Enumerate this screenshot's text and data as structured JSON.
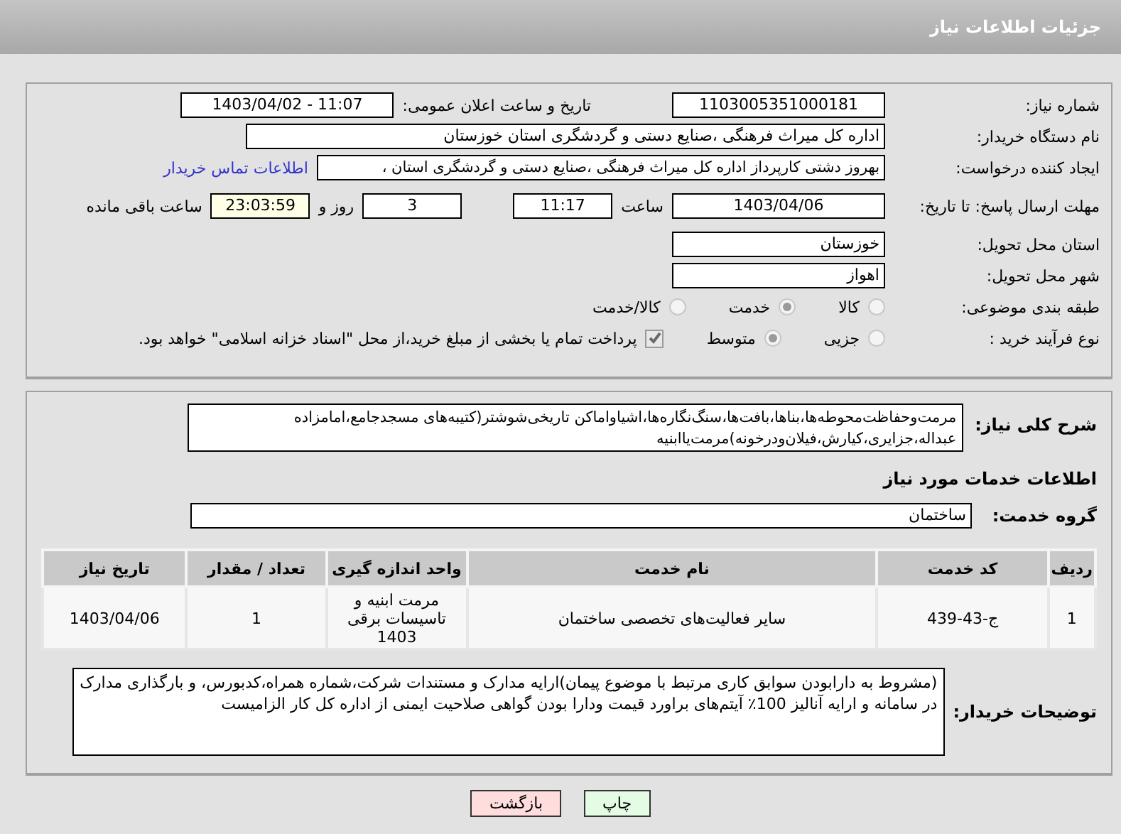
{
  "header": {
    "title": "جزئیات اطلاعات نیاز"
  },
  "need_number": {
    "label": "شماره نیاز:",
    "value": "1103005351000181"
  },
  "announce": {
    "label": "تاریخ و ساعت اعلان عمومی:",
    "value": "1403/04/02 - 11:07"
  },
  "buyer_org": {
    "label": "نام دستگاه خریدار:",
    "value": "اداره کل میراث فرهنگی ،صنایع دستی و گردشگری استان خوزستان"
  },
  "requester": {
    "label": "ایجاد کننده درخواست:",
    "value": "بهروز دشتی کارپرداز اداره کل میراث فرهنگی ،صنایع دستی و گردشگری استان ،",
    "link": "اطلاعات تماس خریدار"
  },
  "deadline": {
    "label": "مهلت ارسال پاسخ: تا تاریخ:",
    "date": "1403/04/06",
    "time_label": "ساعت",
    "time": "11:17",
    "days": "3",
    "days_label": "روز و",
    "remaining": "23:03:59",
    "remaining_label": "ساعت باقی مانده"
  },
  "province": {
    "label": "استان محل تحویل:",
    "value": "خوزستان"
  },
  "city": {
    "label": "شهر محل تحویل:",
    "value": "اهواز"
  },
  "category": {
    "label": "طبقه بندی موضوعی:",
    "options": [
      {
        "label": "کالا",
        "selected": false
      },
      {
        "label": "خدمت",
        "selected": true
      },
      {
        "label": "کالا/خدمت",
        "selected": false
      }
    ]
  },
  "purchase_type": {
    "label": "نوع فرآیند خرید :",
    "options": [
      {
        "label": "جزیی",
        "selected": false
      },
      {
        "label": "متوسط",
        "selected": true
      }
    ],
    "treasury": {
      "checked": true,
      "text": "پرداخت تمام یا بخشی از مبلغ خرید،از محل \"اسناد خزانه اسلامی\" خواهد بود."
    }
  },
  "description": {
    "label": "شرح کلی نیاز:",
    "value": "مرمت‌وحفاظت‌محوطه‌ها،بناها،بافت‌ها،سنگ‌نگاره‌ها،اشیاواماکن تاریخی‌شوشتر(کتیبه‌های مسجدجامع،امامزاده عبداله،جزایری،کیارش،فیلان‌ودرخونه)مرمت‌یاابنیه"
  },
  "services_heading": "اطلاعات خدمات مورد نیاز",
  "service_group": {
    "label": "گروه خدمت:",
    "value": "ساختمان"
  },
  "table": {
    "columns": [
      "ردیف",
      "کد خدمت",
      "نام خدمت",
      "واحد اندازه گیری",
      "تعداد / مقدار",
      "تاریخ نیاز"
    ],
    "rows": [
      [
        "1",
        "ج-43-439",
        "سایر فعالیت‌های تخصصی ساختمان",
        "مرمت ابنیه و تاسیسات برقی 1403",
        "1",
        "1403/04/06"
      ]
    ]
  },
  "buyer_notes": {
    "label": "توضیحات خریدار:",
    "value": "(مشروط به دارابودن سوابق کاری مرتبط با موضوع پیمان)ارایه مدارک و مستندات شرکت،شماره همراه،کدبورس، و بارگذاری مدارک در سامانه و ارایه آنالیز 100٪ آیتم‌های براورد قیمت ودارا بودن گواهی صلاحیت ایمنی از اداره کل کار الزامیست"
  },
  "buttons": [
    {
      "label": "چاپ",
      "kind": "print"
    },
    {
      "label": "بازگشت",
      "kind": "back"
    }
  ]
}
